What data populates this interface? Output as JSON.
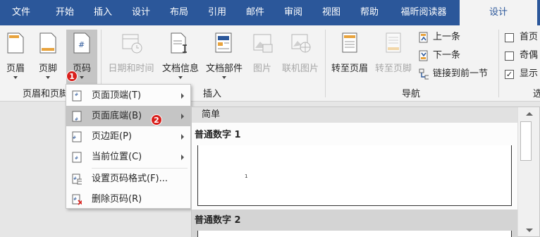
{
  "tabs": [
    "文件",
    "开始",
    "插入",
    "设计",
    "布局",
    "引用",
    "邮件",
    "审阅",
    "视图",
    "帮助",
    "福昕阅读器",
    "设计"
  ],
  "ribbon": {
    "buttons": {
      "header": "页眉",
      "footer": "页脚",
      "page_number": "页码",
      "date_time": "日期和时间",
      "doc_info": "文档信息",
      "doc_parts": "文档部件",
      "picture": "图片",
      "online_picture": "联机图片",
      "goto_header": "转至页眉",
      "goto_footer": "转至页脚"
    },
    "nav": {
      "previous": "上一条",
      "next": "下一条",
      "link_previous": "链接到前一节"
    },
    "options": {
      "first_page": "首页",
      "odd_even": "奇偶",
      "show": "显示"
    },
    "groups": {
      "header_footer": "页眉和页脚",
      "insert": "插入",
      "navigation": "导航",
      "options_cut": "选"
    }
  },
  "badges": {
    "one": "1",
    "two": "2"
  },
  "menu": {
    "items": [
      {
        "label": "页面顶端(T)",
        "submenu": true
      },
      {
        "label": "页面底端(B)",
        "submenu": true
      },
      {
        "label": "页边距(P)",
        "submenu": true
      },
      {
        "label": "当前位置(C)",
        "submenu": true
      },
      {
        "label": "设置页码格式(F)...",
        "submenu": false
      },
      {
        "label": "删除页码(R)",
        "submenu": false
      }
    ]
  },
  "gallery": {
    "header": "简单",
    "item1": "普通数字 1",
    "item2": "普通数字 2",
    "sample_number": "1"
  },
  "colors": {
    "accent": "#2b579a",
    "badge": "#d9201c",
    "highlight": "#c5c5c5"
  }
}
